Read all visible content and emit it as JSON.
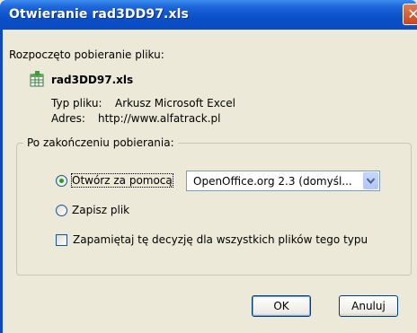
{
  "window": {
    "title": "Otwieranie rad3DD97.xls",
    "close_glyph": "✕"
  },
  "intro": "Rozpoczęto pobieranie pliku:",
  "file": {
    "name": "rad3DD97.xls",
    "type_label": "Typ pliku:",
    "type_value": "Arkusz Microsoft Excel",
    "address_label": "Adres:",
    "address_value": "http://www.alfatrack.pl"
  },
  "after_download": {
    "legend": "Po zakończeniu pobierania:",
    "open_with_label": "Otwórz za pomocą",
    "open_with_selected": true,
    "open_with_app": "OpenOffice.org 2.3 (domyśl...",
    "save_label": "Zapisz plik",
    "remember_label": "Zapamiętaj tę decyzję dla wszystkich plików tego typu",
    "remember_checked": false
  },
  "buttons": {
    "ok": "OK",
    "cancel": "Anuluj"
  }
}
